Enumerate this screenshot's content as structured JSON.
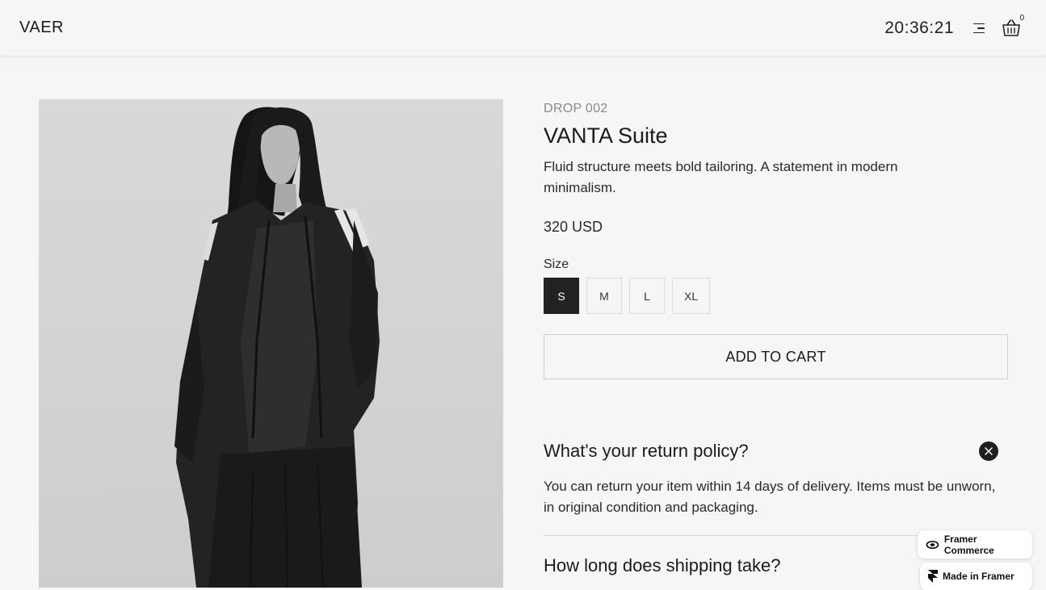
{
  "header": {
    "logo": "VAER",
    "clock": "20:36:21",
    "cart_count": "0"
  },
  "product": {
    "drop": "DROP 002",
    "title": "VANTA Suite",
    "description": "Fluid structure meets bold tailoring. A statement in modern minimalism.",
    "price": "320 USD",
    "size_label": "Size",
    "sizes": [
      "S",
      "M",
      "L",
      "XL"
    ],
    "selected_size": "S",
    "add_to_cart": "ADD TO CART"
  },
  "faq": [
    {
      "question": "What's your return policy?",
      "answer": "You can return your item within 14 days of delivery. Items must be unworn, in original condition and packaging.",
      "expanded": true
    },
    {
      "question": "How long does shipping take?",
      "expanded": false
    }
  ],
  "badges": {
    "commerce": "Framer Commerce",
    "framer": "Made in Framer"
  },
  "colors": {
    "background": "#f6f6f6",
    "text": "#1b1b1b",
    "muted": "#8a8a8a",
    "selected": "#222222"
  }
}
